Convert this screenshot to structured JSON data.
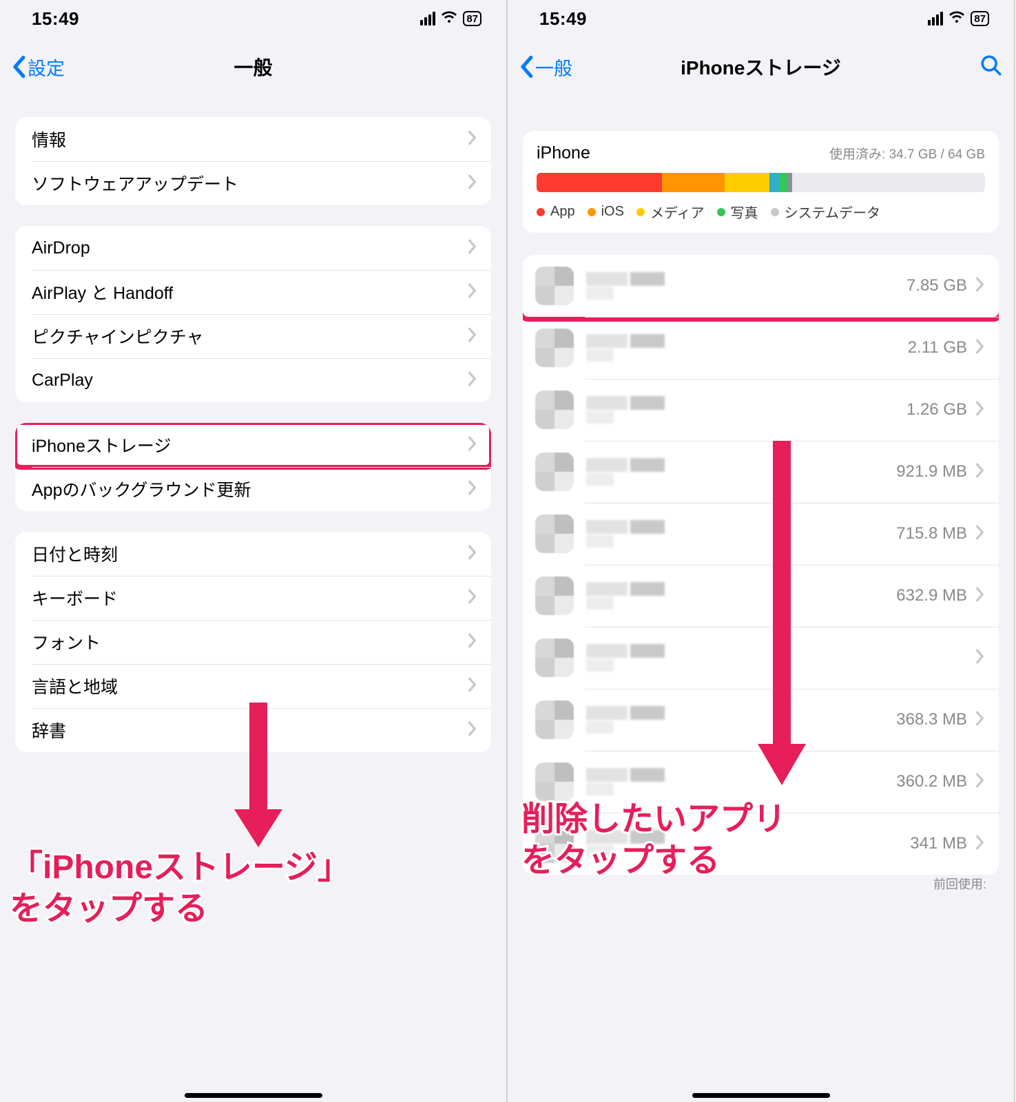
{
  "statusbar": {
    "time": "15:49",
    "battery": "87"
  },
  "left": {
    "back": "設定",
    "title": "一般",
    "group1": {
      "r0": "情報",
      "r1": "ソフトウェアアップデート"
    },
    "group2": {
      "r0": "AirDrop",
      "r1": "AirPlay と Handoff",
      "r2": "ピクチャインピクチャ",
      "r3": "CarPlay"
    },
    "group3": {
      "r0": "iPhoneストレージ",
      "r1": "Appのバックグラウンド更新"
    },
    "group4": {
      "r0": "日付と時刻",
      "r1": "キーボード",
      "r2": "フォント",
      "r3": "言語と地域",
      "r4": "辞書"
    },
    "annotation": "「iPhoneストレージ」\nをタップする"
  },
  "right": {
    "back": "一般",
    "title": "iPhoneストレージ",
    "storage": {
      "device": "iPhone",
      "used_label": "使用済み: 34.7 GB / 64 GB",
      "legend": {
        "app": "App",
        "ios": "iOS",
        "media": "メディア",
        "photo": "写真",
        "sys": "システムデータ"
      }
    },
    "apps": [
      {
        "size": "7.85 GB"
      },
      {
        "size": "2.11 GB"
      },
      {
        "size": "1.26 GB"
      },
      {
        "size": "921.9 MB"
      },
      {
        "size": "715.8 MB"
      },
      {
        "size": "632.9 MB"
      },
      {
        "size": ""
      },
      {
        "size": "368.3 MB"
      },
      {
        "size": "360.2 MB"
      },
      {
        "size": "341 MB"
      }
    ],
    "last_used_label": "前回使用:",
    "annotation": "削除したいアプリ\nをタップする"
  }
}
